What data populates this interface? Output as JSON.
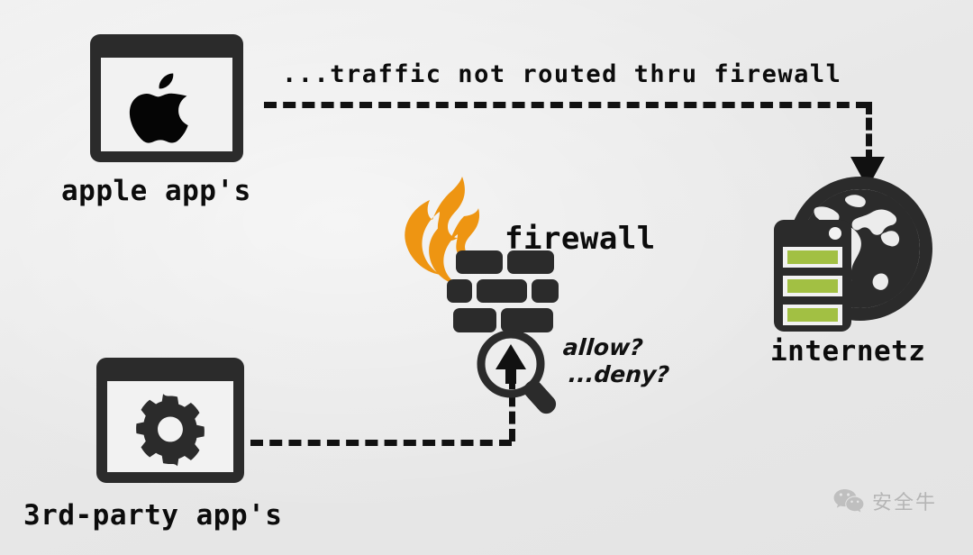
{
  "diagram": {
    "title": "firewall traffic routing diagram",
    "background_color": "#ececec",
    "ink_color": "#1c1c1c",
    "flame_color": "#ee9512",
    "server_led_color": "#a2c043",
    "screen_color": "#f2f2f2"
  },
  "nodes": {
    "apple_app": {
      "label": "apple app's",
      "icon": "apple-logo-window-icon"
    },
    "third_party_app": {
      "label": "3rd-party app's",
      "icon": "gear-window-icon"
    },
    "firewall": {
      "label": "firewall",
      "icon": "flame-brickwall-icon",
      "inspector_icon": "magnifier-arrow-icon",
      "decision_allow": "allow?",
      "decision_deny": "...deny?"
    },
    "internetz": {
      "label": "internetz",
      "icon": "globe-server-icon"
    }
  },
  "connectors": {
    "bypass": {
      "label": "...traffic not routed thru firewall",
      "style": "dashed",
      "from": "apple_app",
      "to": "internetz",
      "arrow": "down-arrow-head"
    },
    "inspected": {
      "label": "",
      "style": "dashed",
      "from": "third_party_app",
      "to": "firewall",
      "arrow": "none"
    }
  },
  "watermark": {
    "icon": "wechat-icon",
    "text": "安全牛"
  }
}
